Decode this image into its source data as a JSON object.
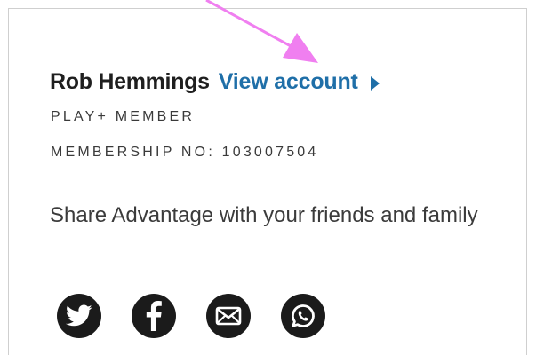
{
  "account": {
    "name": "Rob Hemmings",
    "view_account_label": "View account",
    "tier": "PLAY+ MEMBER",
    "membership_number": "MEMBERSHIP NO: 103007504"
  },
  "share": {
    "text": "Share Advantage with your friends and family",
    "channels": [
      {
        "name": "twitter",
        "icon": "twitter-icon"
      },
      {
        "name": "facebook",
        "icon": "facebook-icon"
      },
      {
        "name": "email",
        "icon": "envelope-icon"
      },
      {
        "name": "whatsapp",
        "icon": "whatsapp-icon"
      }
    ]
  },
  "colors": {
    "link": "#1f6fa8",
    "icon_background": "#1b1b1b",
    "annotation_arrow": "#f07ff0"
  }
}
